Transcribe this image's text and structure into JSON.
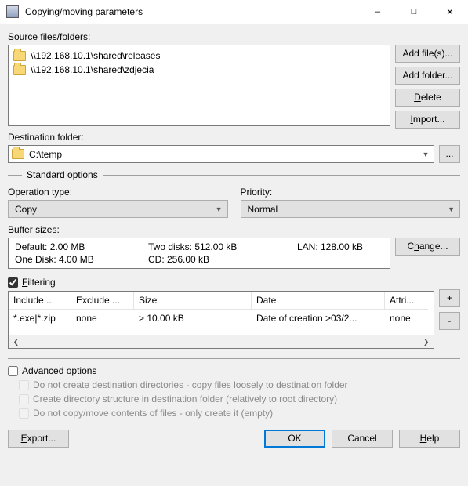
{
  "window": {
    "title": "Copying/moving parameters"
  },
  "labels": {
    "source": "Source files/folders:",
    "destination": "Destination folder:",
    "standard_options": "Standard options",
    "operation_type": "Operation type:",
    "priority": "Priority:",
    "buffer_sizes": "Buffer sizes:",
    "filtering": "Filtering",
    "advanced_options": "Advanced options"
  },
  "source_items": [
    "\\\\192.168.10.1\\shared\\releases",
    "\\\\192.168.10.1\\shared\\zdjecia"
  ],
  "side_buttons": {
    "add_files": "Add file(s)...",
    "add_folder": "Add folder...",
    "delete": "Delete",
    "import": "Import..."
  },
  "destination": {
    "value": "C:\\temp",
    "browse": "..."
  },
  "operation": {
    "value": "Copy"
  },
  "priority": {
    "value": "Normal"
  },
  "buffer": {
    "default": "Default: 2.00 MB",
    "one_disk": "One Disk: 4.00 MB",
    "two_disks": "Two disks: 512.00 kB",
    "cd": "CD: 256.00 kB",
    "lan": "LAN: 128.00 kB",
    "change": "Change..."
  },
  "filtering": {
    "checked": true,
    "headers": {
      "include": "Include ...",
      "exclude": "Exclude ...",
      "size": "Size",
      "date": "Date",
      "attr": "Attri..."
    },
    "row": {
      "include": "*.exe|*.zip",
      "exclude": "none",
      "size": "> 10.00 kB",
      "date": "Date of creation >03/2...",
      "attr": "none"
    },
    "add": "+",
    "remove": "-"
  },
  "advanced": {
    "checked": false,
    "opt1": "Do not create destination directories - copy files loosely to destination folder",
    "opt2": "Create directory structure in destination folder (relatively to root directory)",
    "opt3": "Do not copy/move contents of files - only create it (empty)"
  },
  "footer": {
    "export": "Export...",
    "ok": "OK",
    "cancel": "Cancel",
    "help": "Help"
  }
}
